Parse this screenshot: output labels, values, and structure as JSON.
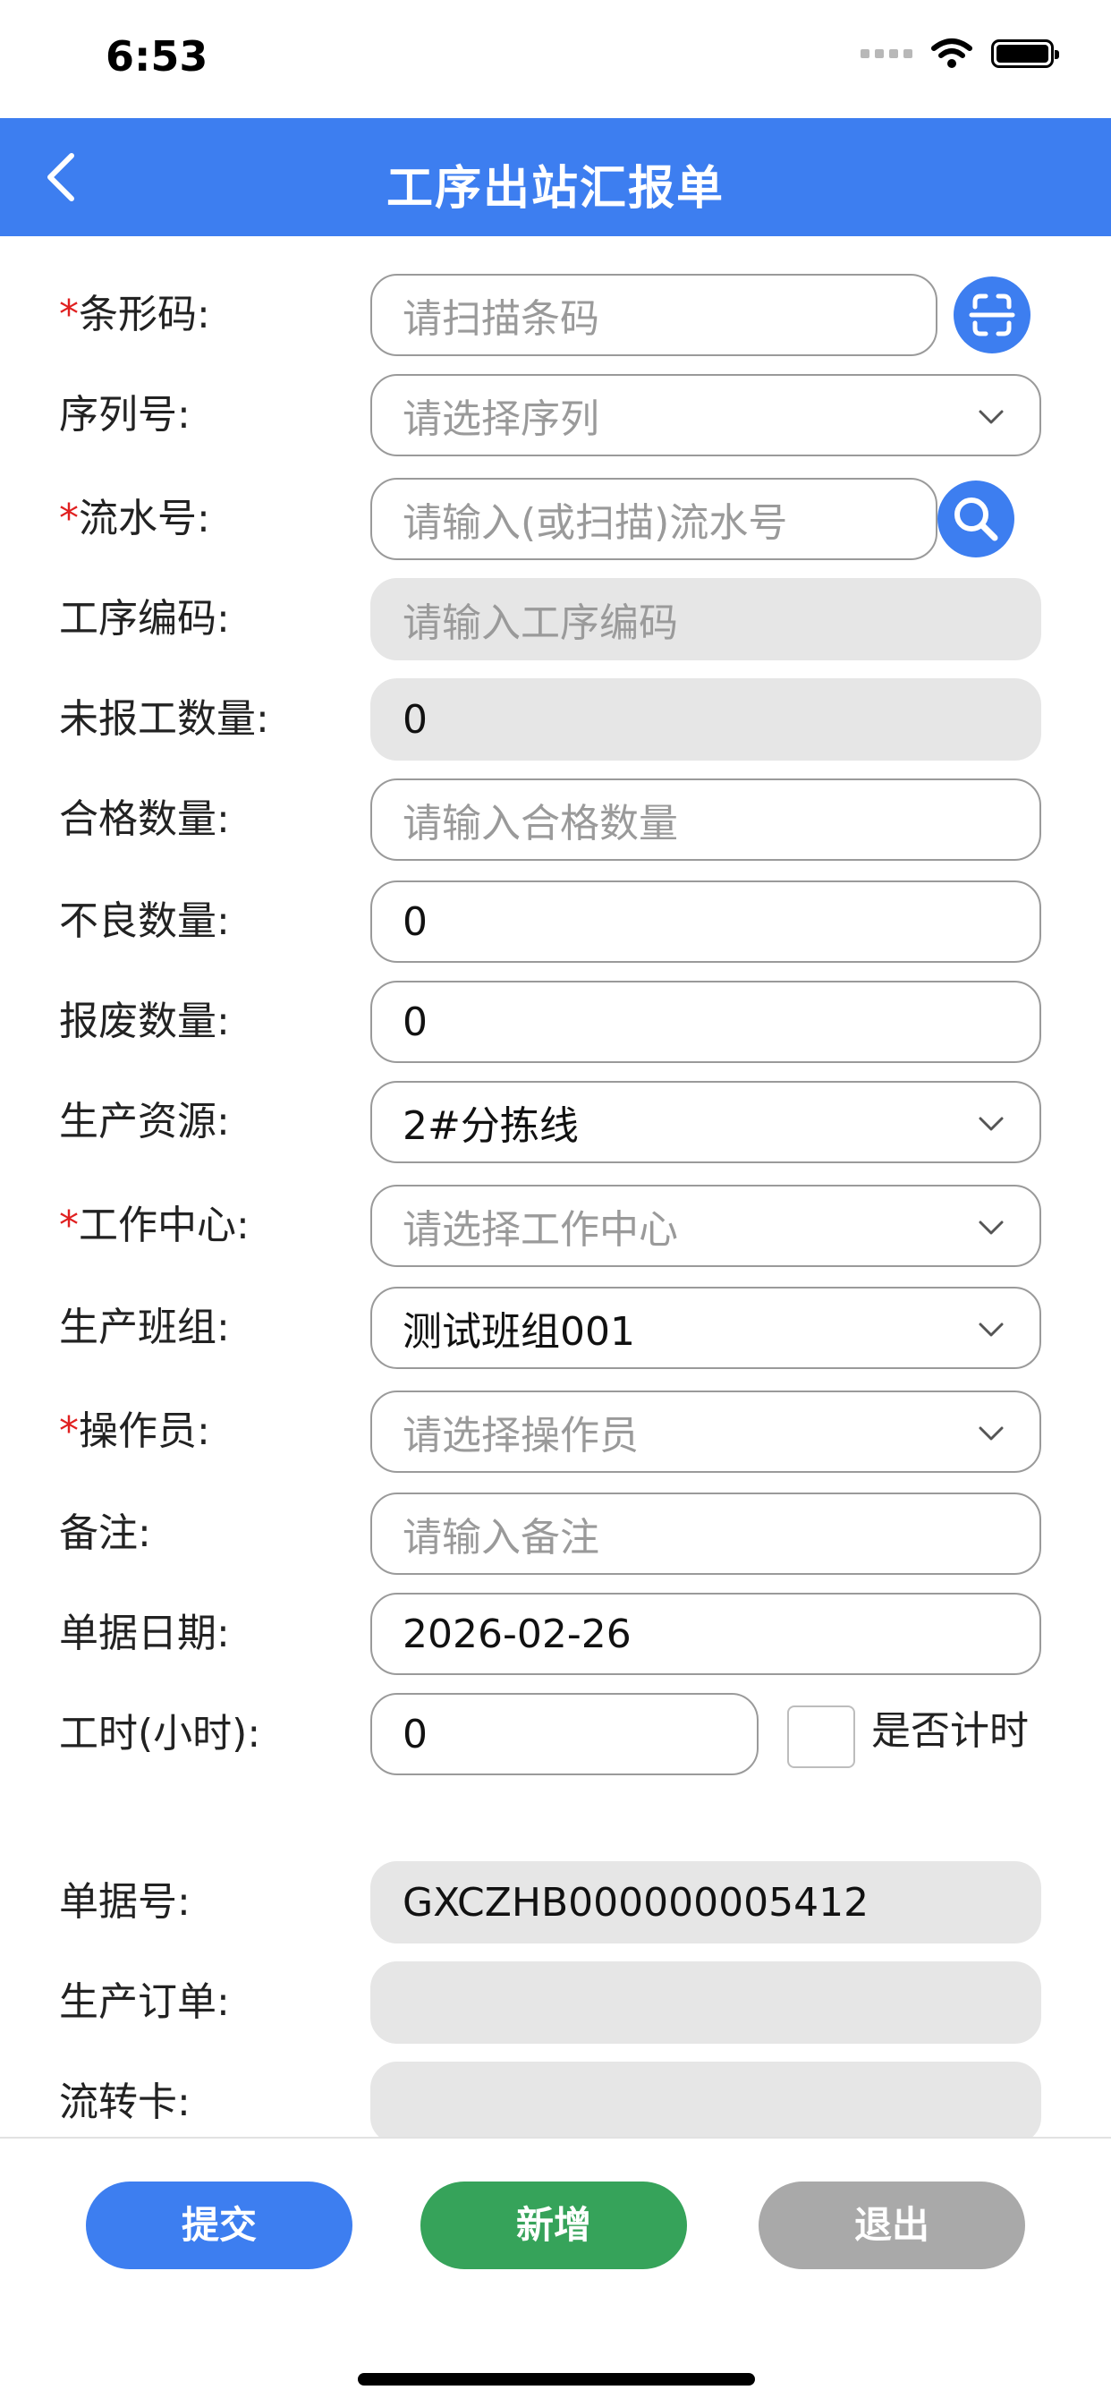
{
  "status": {
    "time": "6:53"
  },
  "nav": {
    "title": "工序出站汇报单"
  },
  "form": {
    "barcode": {
      "required": "*",
      "label": "条形码:",
      "placeholder": "请扫描条码"
    },
    "serial": {
      "label": "序列号:",
      "placeholder": "请选择序列"
    },
    "flow_no": {
      "required": "*",
      "label": "流水号:",
      "placeholder": "请输入(或扫描)流水号"
    },
    "process_code": {
      "label": "工序编码:",
      "placeholder": "请输入工序编码"
    },
    "unreported_qty": {
      "label": "未报工数量:",
      "value": "0"
    },
    "qualified_qty": {
      "label": "合格数量:",
      "placeholder": "请输入合格数量"
    },
    "defect_qty": {
      "label": "不良数量:",
      "value": "0"
    },
    "scrap_qty": {
      "label": "报废数量:",
      "value": "0"
    },
    "resource": {
      "label": "生产资源:",
      "value": "2#分拣线"
    },
    "work_center": {
      "required": "*",
      "label": "工作中心:",
      "placeholder": "请选择工作中心"
    },
    "team": {
      "label": "生产班组:",
      "value": "测试班组001"
    },
    "operator": {
      "required": "*",
      "label": "操作员:",
      "placeholder": "请选择操作员"
    },
    "remark": {
      "label": "备注:",
      "placeholder": "请输入备注"
    },
    "doc_date": {
      "label": "单据日期:",
      "value": "2026-02-26"
    },
    "work_hours": {
      "label": "工时(小时):",
      "value": "0",
      "timing_label": "是否计时"
    },
    "doc_no": {
      "label": "单据号:",
      "value": "GXCZHB000000005412"
    },
    "prod_order": {
      "label": "生产订单:",
      "value": ""
    },
    "flow_card": {
      "label": "流转卡:",
      "value": ""
    }
  },
  "buttons": {
    "submit": "提交",
    "add": "新增",
    "exit": "退出"
  },
  "colors": {
    "primary": "#3d7ef0",
    "success": "#36a35a",
    "disabled": "#a9a9a9",
    "required": "#e02020"
  }
}
